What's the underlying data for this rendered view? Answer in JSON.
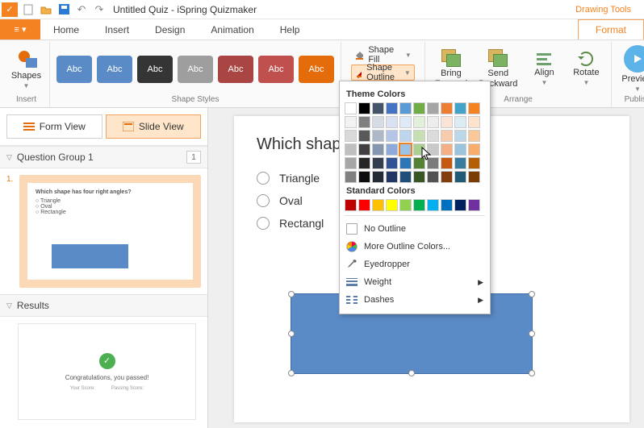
{
  "titlebar": {
    "title": "Untitled Quiz - iSpring Quizmaker"
  },
  "context_tab": {
    "group": "Drawing Tools",
    "tab": "Format"
  },
  "tabs": [
    "Home",
    "Insert",
    "Design",
    "Animation",
    "Help"
  ],
  "ribbon": {
    "insert": {
      "shapes": "Shapes",
      "label": "Insert"
    },
    "shape_styles": {
      "swatches": [
        "Abc",
        "Abc",
        "Abc",
        "Abc",
        "Abc",
        "Abc",
        "Abc"
      ],
      "colors": [
        "#5b8bc7",
        "#5b8bc7",
        "#353535",
        "#9e9e9e",
        "#a94643",
        "#c0504d",
        "#e46c0a"
      ],
      "label": "Shape Styles",
      "fill": "Shape Fill",
      "outline": "Shape Outline"
    },
    "arrange": {
      "bring_fwd": "Bring\nForward",
      "send_bwd": "Send\nBackward",
      "align": "Align",
      "rotate": "Rotate",
      "label": "Arrange"
    },
    "publish": {
      "preview": "Preview",
      "label": "Publish"
    }
  },
  "view_toggle": {
    "form": "Form View",
    "slide": "Slide View"
  },
  "question_group": {
    "title": "Question Group 1",
    "count": "1"
  },
  "slide_thumb": {
    "num": "1.",
    "question": "Which shape has four right angles?",
    "opts": [
      "Triangle",
      "Oval",
      "Rectangle"
    ]
  },
  "results": {
    "title": "Results",
    "msg": "Congratulations, you passed!",
    "l1": "Your Score:",
    "l2": "Passing Score:"
  },
  "slide": {
    "title": "Which shap",
    "choices": [
      "Triangle",
      "Oval",
      "Rectangl"
    ]
  },
  "popup": {
    "theme_label": "Theme Colors",
    "std_label": "Standard Colors",
    "no_outline": "No Outline",
    "more": "More Outline Colors...",
    "eyedropper": "Eyedropper",
    "weight": "Weight",
    "dashes": "Dashes",
    "theme_row": [
      "#ffffff",
      "#000000",
      "#44546a",
      "#4472c4",
      "#5b9bd5",
      "#70ad47",
      "#a5a5a5",
      "#ed7d31",
      "#44a3c9",
      "#f58220"
    ],
    "theme_tints": [
      [
        "#f2f2f2",
        "#7f7f7f",
        "#d6dce5",
        "#d9e1f2",
        "#deeaf6",
        "#e2efda",
        "#ededed",
        "#fbe4d5",
        "#ddebf3",
        "#fde3cb"
      ],
      [
        "#d9d9d9",
        "#595959",
        "#adb9ca",
        "#b4c6e7",
        "#bdd6ee",
        "#c6e0b4",
        "#dbdbdb",
        "#f8cbad",
        "#bcd7e7",
        "#fbc89a"
      ],
      [
        "#bfbfbf",
        "#404040",
        "#8496b0",
        "#8ea9db",
        "#9cc2e5",
        "#a9d08e",
        "#c9c9c9",
        "#f4b084",
        "#9bc3db",
        "#f8ad6a"
      ],
      [
        "#a6a6a6",
        "#262626",
        "#333f4f",
        "#305496",
        "#2e75b5",
        "#548235",
        "#7b7b7b",
        "#c65911",
        "#3a7ca0",
        "#b45f06"
      ],
      [
        "#808080",
        "#0d0d0d",
        "#222a35",
        "#203764",
        "#1f4e78",
        "#375623",
        "#525252",
        "#833c0c",
        "#215a74",
        "#7a3c02"
      ]
    ],
    "std_colors": [
      "#c00000",
      "#ff0000",
      "#ffc000",
      "#ffff00",
      "#92d050",
      "#00b050",
      "#00b0f0",
      "#0070c0",
      "#002060",
      "#7030a0"
    ]
  },
  "checked_tint": {
    "row": 2,
    "col": 4
  }
}
